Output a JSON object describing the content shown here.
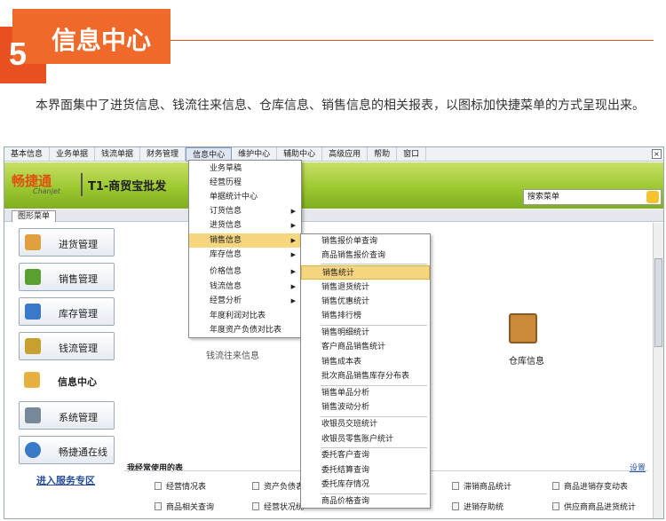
{
  "section": {
    "number": "5",
    "title": "信息中心"
  },
  "description": "本界面集中了进货信息、钱流往来信息、仓库信息、销售信息的相关报表，以图标加快捷菜单的方式呈现出来。",
  "menubar": {
    "items": [
      "基本信息",
      "业务单据",
      "钱流单据",
      "财务管理",
      "信息中心",
      "维护中心",
      "辅助中心",
      "高级应用",
      "帮助",
      "窗口"
    ],
    "close": "×"
  },
  "banner": {
    "logo_text": "畅捷通",
    "logo_sub": "Chanjet",
    "product": "T1-商贸宝批发",
    "search_label": "搜索菜单"
  },
  "tabs": [
    "图形菜单"
  ],
  "sidebar": {
    "items": [
      {
        "label": "进货管理",
        "icon": "cart-icon",
        "color": "#e0a040"
      },
      {
        "label": "销售管理",
        "icon": "basket-icon",
        "color": "#5aa030"
      },
      {
        "label": "库存管理",
        "icon": "grid-icon",
        "color": "#3a78c8"
      },
      {
        "label": "钱流管理",
        "icon": "abacus-icon",
        "color": "#c8a030"
      },
      {
        "label": "信息中心",
        "icon": "info-folder-icon",
        "color": "#e6b040"
      },
      {
        "label": "系统管理",
        "icon": "system-icon",
        "color": "#778899"
      },
      {
        "label": "畅捷通在线",
        "icon": "globe-icon",
        "color": "#3a78c8"
      }
    ],
    "service_link": "进入服务专区"
  },
  "main": {
    "ghost_label": "钱流往来信息",
    "warehouse_label": "仓库信息",
    "frequent_title": "我经常使用的表",
    "frequent_settings": "设置",
    "frequent_items": [
      [
        "经营情况表",
        "资产负债表",
        "",
        "滞销商品统计",
        "商品进销存变动表"
      ],
      [
        "商品相关查询",
        "经营状况统",
        "",
        "进销存助统",
        "供应商商品进货统计"
      ]
    ]
  },
  "menu_level1": {
    "items": [
      {
        "label": "业务草稿",
        "arrow": ""
      },
      {
        "label": "经营历程",
        "arrow": ""
      },
      {
        "label": "单据统计中心",
        "arrow": ""
      },
      {
        "label": "订货信息",
        "arrow": "▶"
      },
      {
        "label": "进货信息",
        "arrow": "▶"
      },
      {
        "label": "销售信息",
        "arrow": "▶"
      },
      {
        "label": "库存信息",
        "arrow": "▶"
      },
      {
        "label": "价格信息",
        "arrow": "▶"
      },
      {
        "label": "钱流信息",
        "arrow": "▶"
      },
      {
        "label": "经营分析",
        "arrow": "▶"
      },
      {
        "label": "年度利润对比表",
        "arrow": ""
      },
      {
        "label": "年度资产负债对比表",
        "arrow": ""
      }
    ],
    "highlighted": 5
  },
  "menu_level2": {
    "items": [
      "销售报价单查询",
      "商品销售报价查询",
      "销售统计",
      "销售退货统计",
      "销售优惠统计",
      "销售排行榜",
      "销售明细统计",
      "客户商品销售统计",
      "销售成本表",
      "批次商品销售库存分布表",
      "销售单品分析",
      "销售波动分析",
      "收银员交班统计",
      "收银员零售账户统计",
      "委托客户查询",
      "委托结算查询",
      "委托库存情况",
      "商品价格查询"
    ],
    "highlighted": 2
  }
}
